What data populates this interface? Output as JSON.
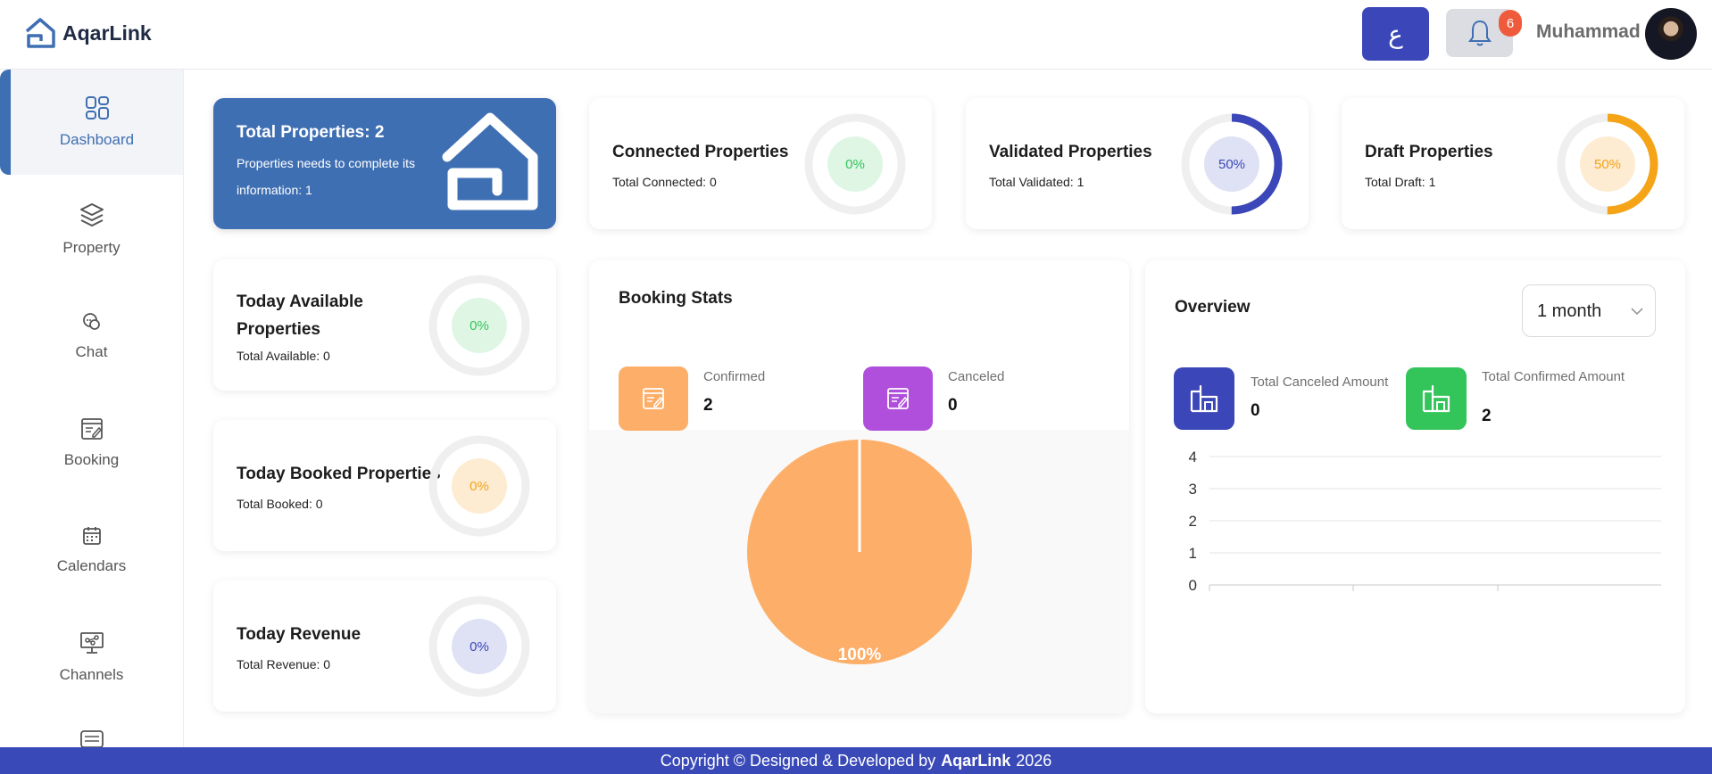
{
  "header": {
    "logo_text": "AqarLink",
    "lang_label": "ع",
    "notification_count": "6",
    "user_name": "Muhammad"
  },
  "sidebar": {
    "items": [
      {
        "label": "Dashboard",
        "icon": "dashboard-icon"
      },
      {
        "label": "Property",
        "icon": "layers-icon"
      },
      {
        "label": "Chat",
        "icon": "chat-icon"
      },
      {
        "label": "Booking",
        "icon": "booking-icon"
      },
      {
        "label": "Calendars",
        "icon": "calendar-icon"
      },
      {
        "label": "Channels",
        "icon": "channels-icon"
      }
    ]
  },
  "summary": {
    "total_title": "Total Properties: 2",
    "total_sub": "Properties needs to complete its information: 1",
    "connected": {
      "title": "Connected Properties",
      "sub": "Total Connected: 0",
      "percent": "0%",
      "value": 0
    },
    "validated": {
      "title": "Validated Properties",
      "sub": "Total Validated: 1",
      "percent": "50%",
      "value": 50
    },
    "draft": {
      "title": "Draft Properties",
      "sub": "Total Draft: 1",
      "percent": "50%",
      "value": 50
    }
  },
  "today": {
    "available": {
      "title_line1": "Today Available",
      "title_line2": "Properties",
      "sub": "Total Available: 0",
      "percent": "0%"
    },
    "booked": {
      "title": "Today Booked Properties",
      "sub": "Total Booked: 0",
      "percent": "0%"
    },
    "revenue": {
      "title": "Today Revenue",
      "sub": "Total Revenue: 0",
      "percent": "0%"
    }
  },
  "booking_stats": {
    "title": "Booking Stats",
    "confirmed_label": "Confirmed",
    "confirmed_value": "2",
    "canceled_label": "Canceled",
    "canceled_value": "0",
    "pie_label": "100%"
  },
  "overview": {
    "title": "Overview",
    "period": "1 month",
    "canceled_amount_label": "Total Canceled Amount",
    "canceled_amount_value": "0",
    "confirmed_amount_label": "Total Confirmed Amount",
    "confirmed_amount_value": "2"
  },
  "colors": {
    "primary": "#3f6fb3",
    "indigo": "#3b47b8",
    "orange": "#fdae68",
    "purple": "#b04fdc",
    "green": "#33c45a"
  },
  "chart_data": [
    {
      "type": "pie",
      "categories": [
        "Confirmed",
        "Canceled"
      ],
      "values": [
        2,
        0
      ],
      "labels": [
        "100%"
      ]
    },
    {
      "type": "line",
      "y_ticks": [
        0,
        1,
        2,
        3,
        4
      ],
      "ylim": [
        0,
        4
      ],
      "series": []
    }
  ],
  "footer": {
    "prefix": "Copyright © Designed & Developed by",
    "brand": "AqarLink",
    "year": "2026"
  }
}
